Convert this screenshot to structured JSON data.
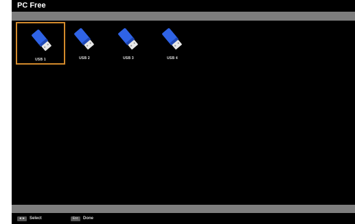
{
  "window": {
    "title": "PC Free"
  },
  "devices": [
    {
      "label": "USB 1",
      "selected": true,
      "icon": "usb-drive-icon"
    },
    {
      "label": "USB 2",
      "selected": false,
      "icon": "usb-drive-icon"
    },
    {
      "label": "USB 3",
      "selected": false,
      "icon": "usb-drive-icon"
    },
    {
      "label": "USB 4",
      "selected": false,
      "icon": "usb-drive-icon"
    }
  ],
  "footer": {
    "select_key": "◄►",
    "select_label": "Select",
    "exit_key": "Esc",
    "exit_label": "Done"
  },
  "colors": {
    "selection_border": "#d38a2b",
    "bars": "#7e7e7e",
    "usb_body": "#2f63e6"
  }
}
